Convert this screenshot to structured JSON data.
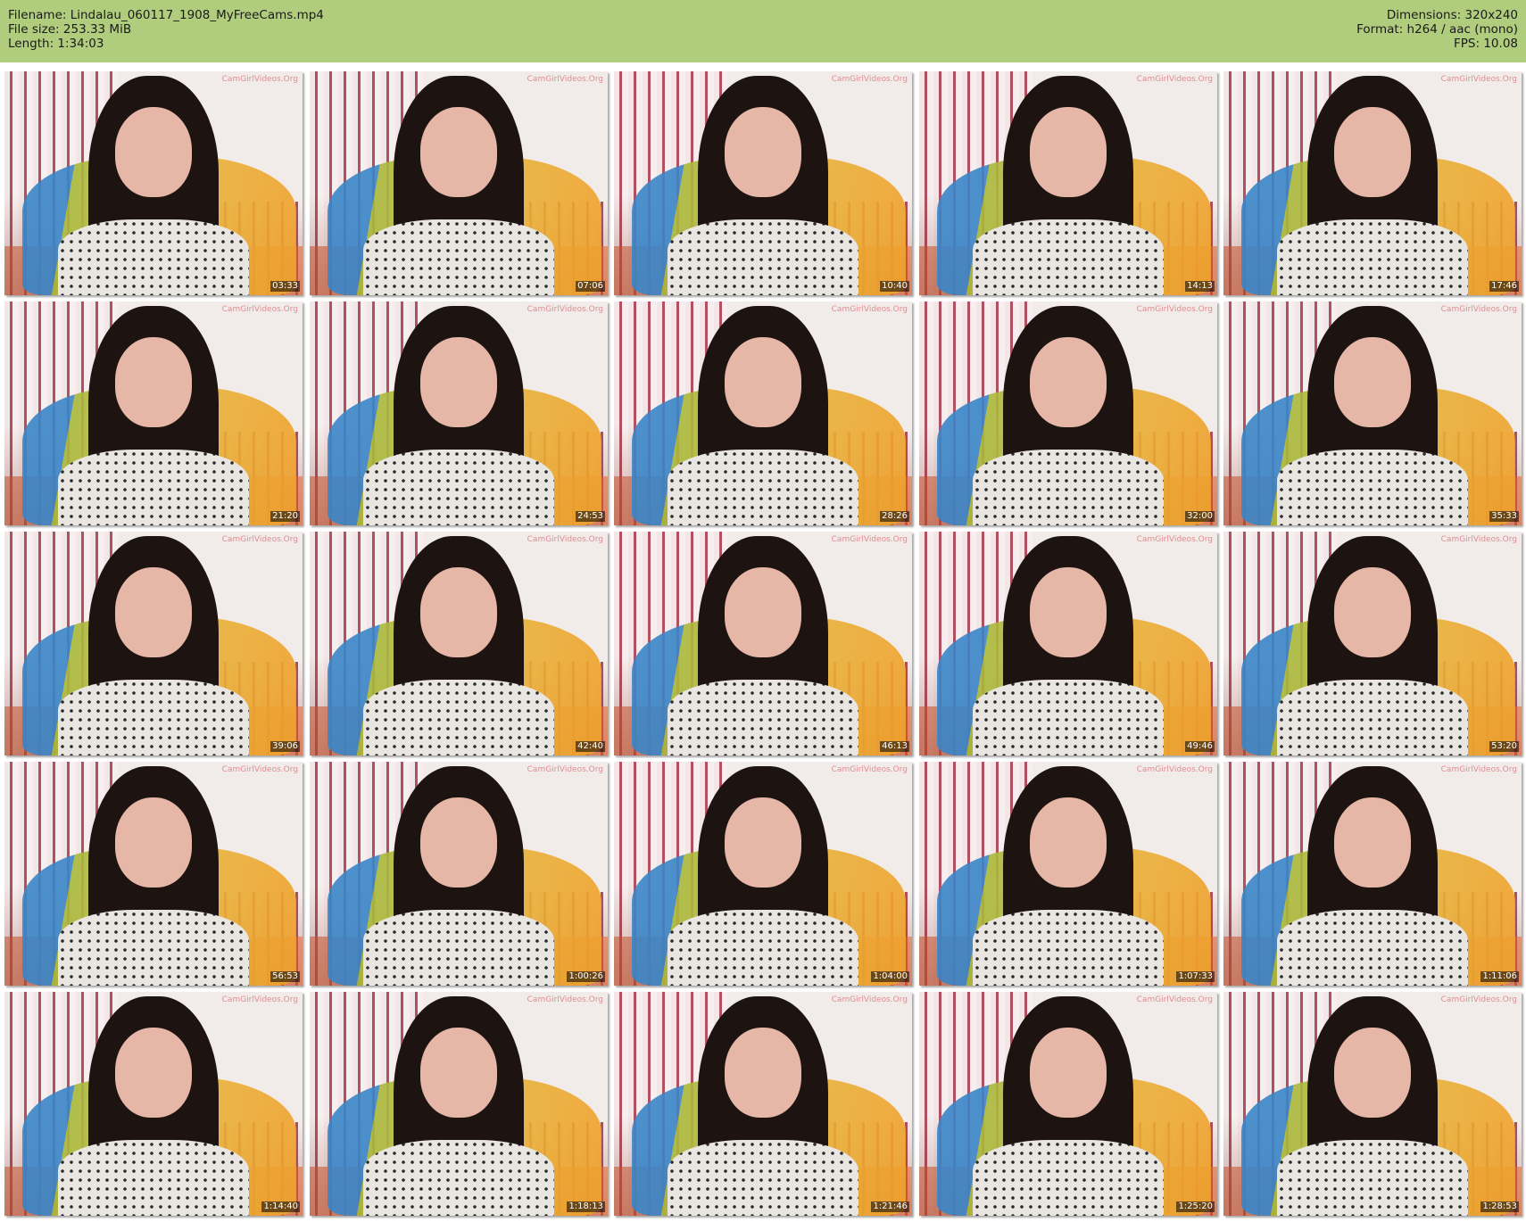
{
  "header": {
    "filename": "Filename: Lindalau_060117_1908_MyFreeCams.mp4",
    "filesize": "File size: 253.33 MiB",
    "length": "Length: 1:34:03",
    "dimensions": "Dimensions: 320x240",
    "format": "Format: h264 / aac (mono)",
    "fps": "FPS: 10.08"
  },
  "colors": {
    "header_bg": "#b0cd7e",
    "page_bg": "#ffffff"
  },
  "watermark": "CamGirlVideos.Org",
  "thumbnails": [
    {
      "time": "03:33"
    },
    {
      "time": "07:06"
    },
    {
      "time": "10:40"
    },
    {
      "time": "14:13"
    },
    {
      "time": "17:46"
    },
    {
      "time": "21:20"
    },
    {
      "time": "24:53"
    },
    {
      "time": "28:26"
    },
    {
      "time": "32:00"
    },
    {
      "time": "35:33"
    },
    {
      "time": "39:06"
    },
    {
      "time": "42:40"
    },
    {
      "time": "46:13"
    },
    {
      "time": "49:46"
    },
    {
      "time": "53:20"
    },
    {
      "time": "56:53"
    },
    {
      "time": "1:00:26"
    },
    {
      "time": "1:04:00"
    },
    {
      "time": "1:07:33"
    },
    {
      "time": "1:11:06"
    },
    {
      "time": "1:14:40"
    },
    {
      "time": "1:18:13"
    },
    {
      "time": "1:21:46"
    },
    {
      "time": "1:25:20"
    },
    {
      "time": "1:28:53"
    }
  ]
}
